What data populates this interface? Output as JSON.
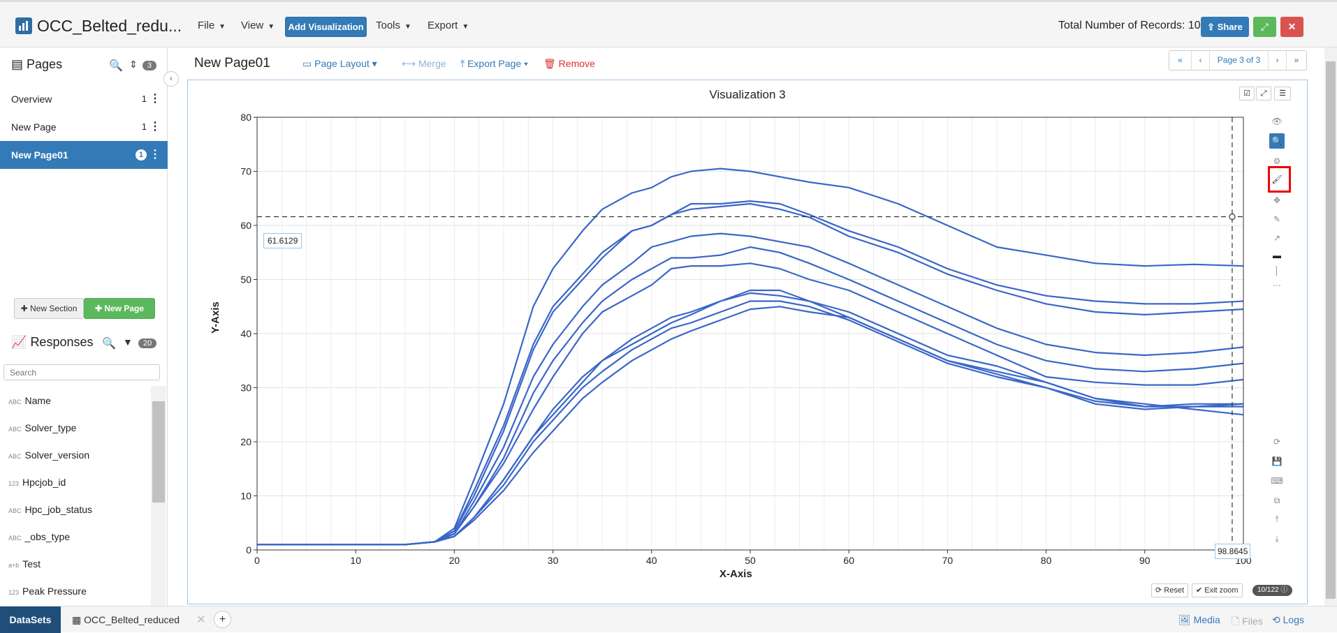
{
  "header": {
    "app_title": "OCC_Belted_redu...",
    "menus": [
      "File",
      "View",
      "Tools",
      "Export"
    ],
    "add_visualization": "Add Visualization",
    "records_label": "Total Number of Records: 10",
    "share": "Share"
  },
  "sidebar": {
    "pages_title": "Pages",
    "pages_count": "3",
    "pages": [
      {
        "label": "Overview",
        "count": "1"
      },
      {
        "label": "New Page",
        "count": "1"
      },
      {
        "label": "New Page01",
        "count": "1"
      }
    ],
    "new_section": "New Section",
    "new_page": "New Page",
    "responses_title": "Responses",
    "responses_count": "20",
    "search_placeholder": "Search",
    "responses": [
      {
        "type": "ABC",
        "label": "Name"
      },
      {
        "type": "ABC",
        "label": "Solver_type"
      },
      {
        "type": "ABC",
        "label": "Solver_version"
      },
      {
        "type": "123",
        "label": "Hpcjob_id"
      },
      {
        "type": "ABC",
        "label": "Hpc_job_status"
      },
      {
        "type": "ABC",
        "label": "_obs_type"
      },
      {
        "type": "a+b",
        "label": "Test"
      },
      {
        "type": "123",
        "label": "Peak Pressure"
      }
    ]
  },
  "page": {
    "title": "New Page01",
    "page_layout": "Page Layout",
    "merge": "Merge",
    "export_page": "Export Page",
    "remove": "Remove",
    "pager_label": "Page 3 of 3"
  },
  "viz": {
    "title": "Visualization 3",
    "reset": "Reset",
    "exit_zoom": "Exit zoom",
    "points_badge": "10/122",
    "crosshair_y_label": "61.6129",
    "crosshair_x_label": "98.8645"
  },
  "bottom": {
    "datasets": "DataSets",
    "dataset_tab": "OCC_Belted_reduced",
    "media": "Media",
    "files": "Files",
    "logs": "Logs"
  },
  "colors": {
    "primary": "#337ab7",
    "success": "#5cb85c",
    "danger": "#d9534f",
    "line": "#3a66c8"
  },
  "chart_data": {
    "type": "line",
    "title": "Visualization 3",
    "xlabel": "X-Axis",
    "ylabel": "Y-Axis",
    "xlim": [
      0,
      100
    ],
    "ylim": [
      0,
      80
    ],
    "xticks": [
      0,
      10,
      20,
      30,
      40,
      50,
      60,
      70,
      80,
      90,
      100
    ],
    "yticks": [
      0,
      10,
      20,
      30,
      40,
      50,
      60,
      70,
      80
    ],
    "grid": true,
    "crosshair": {
      "x": 98.8645,
      "y": 61.6129
    },
    "series": [
      {
        "x": [
          0,
          15,
          18,
          20,
          22,
          25,
          28,
          30,
          33,
          35,
          38,
          40,
          42,
          44,
          47,
          50,
          53,
          56,
          60,
          65,
          70,
          75,
          80,
          85,
          90,
          95,
          100
        ],
        "y": [
          1,
          1,
          1.5,
          4,
          13,
          27,
          45,
          52,
          59,
          63,
          66,
          67,
          69,
          70,
          70.5,
          70,
          69,
          68,
          67,
          64,
          60,
          56,
          54.5,
          53,
          52.5,
          52.8,
          52.5
        ]
      },
      {
        "x": [
          0,
          15,
          18,
          20,
          22,
          25,
          28,
          30,
          33,
          35,
          38,
          40,
          42,
          44,
          47,
          50,
          53,
          56,
          60,
          65,
          70,
          75,
          80,
          85,
          90,
          95,
          100
        ],
        "y": [
          1,
          1,
          1.5,
          3.5,
          11,
          23,
          38,
          45,
          51,
          55,
          59,
          60,
          62,
          64,
          64,
          64.5,
          64,
          62,
          59,
          56,
          52,
          49,
          47,
          46,
          45.5,
          45.5,
          46
        ]
      },
      {
        "x": [
          0,
          15,
          18,
          20,
          22,
          25,
          28,
          30,
          33,
          35,
          38,
          40,
          42,
          44,
          47,
          50,
          53,
          56,
          60,
          65,
          70,
          75,
          80,
          85,
          90,
          95,
          100
        ],
        "y": [
          1,
          1,
          1.5,
          3.5,
          10,
          22,
          37,
          44,
          50,
          54,
          59,
          60,
          62,
          63,
          63.5,
          64,
          63,
          61.5,
          58,
          55,
          51,
          48,
          45.5,
          44,
          43.5,
          44,
          44.5
        ]
      },
      {
        "x": [
          0,
          15,
          18,
          20,
          22,
          25,
          28,
          30,
          33,
          35,
          38,
          40,
          42,
          44,
          47,
          50,
          53,
          56,
          60,
          65,
          70,
          75,
          80,
          85,
          90,
          95,
          100
        ],
        "y": [
          1,
          1,
          1.5,
          3,
          9,
          19,
          32,
          38,
          45,
          49,
          53,
          56,
          57,
          58,
          58.5,
          58,
          57,
          56,
          53,
          49,
          45,
          41,
          38,
          36.5,
          36,
          36.5,
          37.5
        ]
      },
      {
        "x": [
          0,
          15,
          18,
          20,
          22,
          25,
          28,
          30,
          33,
          35,
          38,
          40,
          42,
          44,
          47,
          50,
          53,
          56,
          60,
          65,
          70,
          75,
          80,
          85,
          90,
          95,
          100
        ],
        "y": [
          1,
          1,
          1.5,
          3,
          8,
          17,
          29,
          35,
          42,
          46,
          50,
          52,
          54,
          54,
          54.5,
          56,
          55,
          53,
          50,
          46,
          42,
          38,
          35,
          33.5,
          33,
          33.5,
          34.5
        ]
      },
      {
        "x": [
          0,
          15,
          18,
          20,
          22,
          25,
          28,
          30,
          33,
          35,
          38,
          40,
          42,
          44,
          47,
          50,
          53,
          56,
          60,
          65,
          70,
          75,
          80,
          85,
          90,
          95,
          100
        ],
        "y": [
          1,
          1,
          1.5,
          3,
          8,
          16,
          26,
          32,
          40,
          44,
          47,
          49,
          52,
          52.5,
          52.5,
          53,
          52,
          50,
          48,
          44,
          40,
          36,
          32,
          31,
          30.5,
          30.5,
          31.5
        ]
      },
      {
        "x": [
          0,
          15,
          18,
          20,
          22,
          25,
          28,
          30,
          33,
          35,
          38,
          40,
          42,
          44,
          47,
          50,
          53,
          56,
          60,
          65,
          70,
          75,
          80,
          85,
          90,
          95,
          100
        ],
        "y": [
          1,
          1,
          1.5,
          2.5,
          6,
          13,
          21,
          26,
          32,
          35,
          39,
          41,
          43,
          44,
          46,
          48,
          48,
          46,
          44,
          40,
          36,
          34,
          31,
          28,
          26.5,
          26.5,
          26.5
        ]
      },
      {
        "x": [
          0,
          15,
          18,
          20,
          22,
          25,
          28,
          30,
          33,
          35,
          38,
          40,
          42,
          44,
          47,
          50,
          53,
          56,
          60,
          65,
          70,
          75,
          80,
          85,
          90,
          95,
          100
        ],
        "y": [
          1,
          1,
          1.5,
          2.5,
          6,
          13,
          21,
          25,
          31,
          35,
          38,
          40,
          42,
          43.5,
          46,
          47.5,
          47,
          46,
          43,
          39,
          35,
          33,
          31,
          28,
          27,
          26,
          25
        ]
      },
      {
        "x": [
          0,
          15,
          18,
          20,
          22,
          25,
          28,
          30,
          33,
          35,
          38,
          40,
          42,
          44,
          47,
          50,
          53,
          56,
          60,
          65,
          70,
          75,
          80,
          85,
          90,
          95,
          100
        ],
        "y": [
          1,
          1,
          1.5,
          2.5,
          6,
          12,
          20,
          24,
          30,
          33,
          37,
          39,
          41,
          42,
          44,
          46,
          46,
          45,
          42.5,
          38.5,
          34.5,
          32,
          30,
          27.5,
          26.5,
          27,
          27
        ]
      },
      {
        "x": [
          0,
          15,
          18,
          20,
          22,
          25,
          28,
          30,
          33,
          35,
          38,
          40,
          42,
          44,
          47,
          50,
          53,
          56,
          60,
          65,
          70,
          75,
          80,
          85,
          90,
          95,
          100
        ],
        "y": [
          1,
          1,
          1.5,
          2.5,
          5.5,
          11,
          18,
          22,
          28,
          31,
          35,
          37,
          39,
          40.5,
          42.5,
          44.5,
          45,
          44,
          43,
          39,
          35,
          32.5,
          30,
          27,
          26,
          26.5,
          27
        ]
      }
    ]
  }
}
